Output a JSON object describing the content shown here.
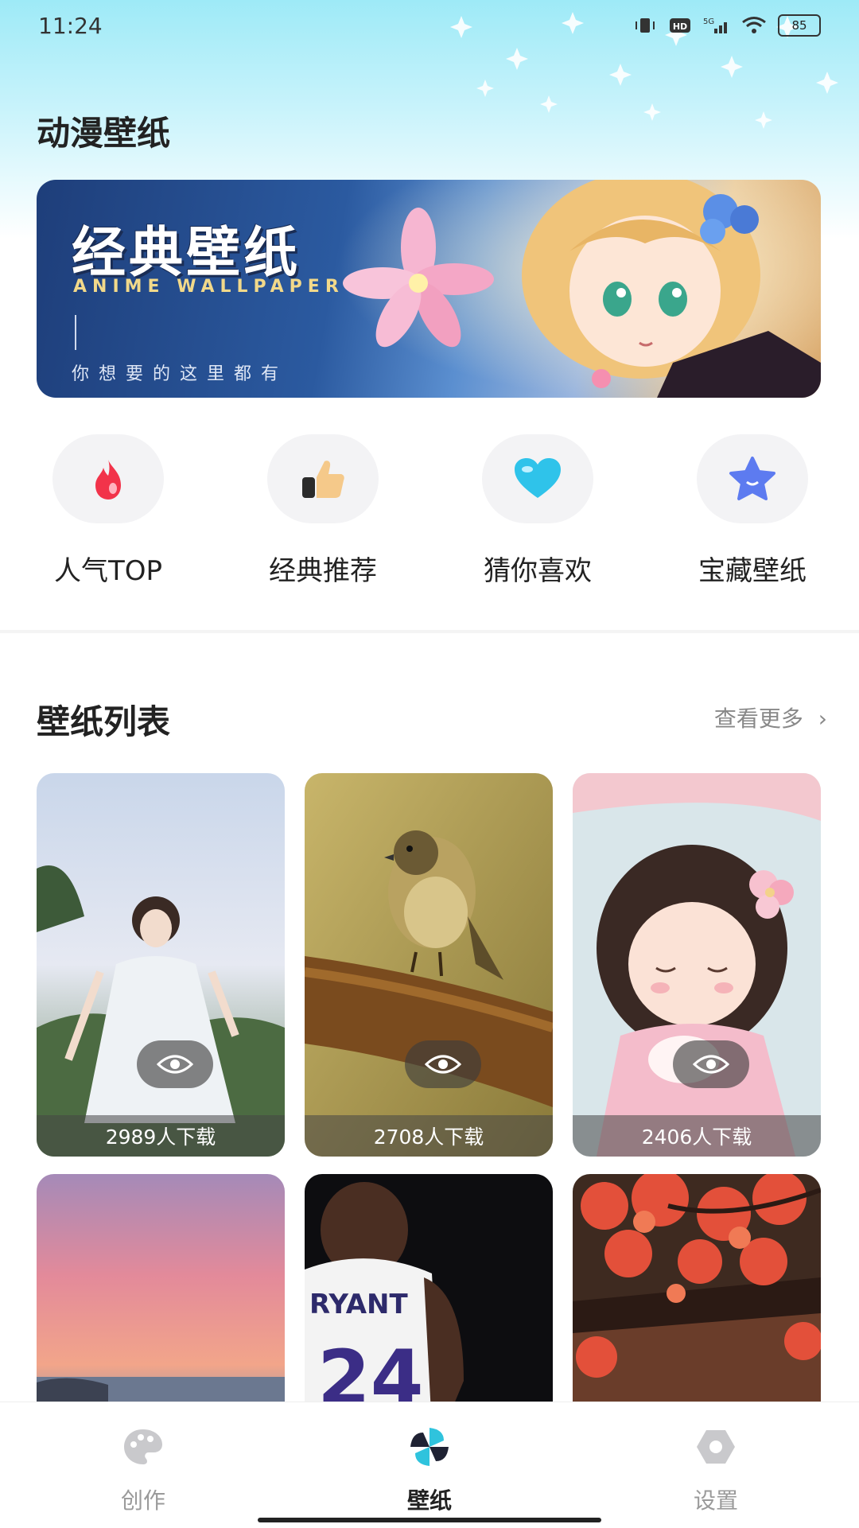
{
  "status": {
    "time": "11:24",
    "battery": "85"
  },
  "page": {
    "title": "动漫壁纸"
  },
  "banner": {
    "title": "经典壁纸",
    "subtitle": "ANIME WALLPAPER",
    "note": "你想要的这里都有"
  },
  "categories": [
    {
      "label": "人气TOP",
      "icon": "flame-icon"
    },
    {
      "label": "经典推荐",
      "icon": "thumbs-up-icon"
    },
    {
      "label": "猜你喜欢",
      "icon": "heart-icon"
    },
    {
      "label": "宝藏壁纸",
      "icon": "star-icon"
    }
  ],
  "wallpaper_list": {
    "title": "壁纸列表",
    "more": "查看更多",
    "items": [
      {
        "downloads": "2989人下载",
        "subject": "girl in white dress"
      },
      {
        "downloads": "2708人下载",
        "subject": "bird on branch"
      },
      {
        "downloads": "2406人下载",
        "subject": "anime girl with flower"
      },
      {
        "subject": "pink sunset sky"
      },
      {
        "subject": "basketball player 24"
      },
      {
        "subject": "red blossom tree"
      }
    ]
  },
  "nav": [
    {
      "label": "创作",
      "icon": "palette-icon",
      "active": false
    },
    {
      "label": "壁纸",
      "icon": "pinwheel-icon",
      "active": true
    },
    {
      "label": "设置",
      "icon": "settings-icon",
      "active": false
    }
  ],
  "colors": {
    "accent": "#2fc3dd",
    "top_gradient": "#9eeaf7"
  }
}
